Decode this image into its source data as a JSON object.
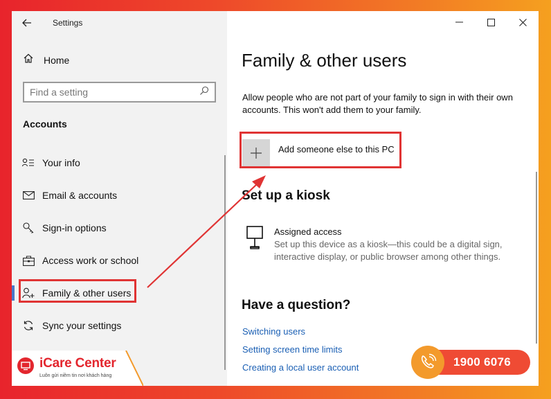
{
  "app": {
    "title": "Settings"
  },
  "sidebar": {
    "home_label": "Home",
    "search_placeholder": "Find a setting",
    "section_title": "Accounts",
    "items": [
      {
        "label": "Your info",
        "icon": "person-list-icon"
      },
      {
        "label": "Email & accounts",
        "icon": "mail-icon"
      },
      {
        "label": "Sign-in options",
        "icon": "key-icon"
      },
      {
        "label": "Access work or school",
        "icon": "briefcase-icon"
      },
      {
        "label": "Family & other users",
        "icon": "person-add-icon",
        "selected": true
      },
      {
        "label": "Sync your settings",
        "icon": "sync-icon"
      }
    ]
  },
  "content": {
    "title": "Family & other users",
    "description": "Allow people who are not part of your family to sign in with their own accounts. This won't add them to your family.",
    "add_label": "Add someone else to this PC",
    "kiosk_title": "Set up a kiosk",
    "kiosk_item": {
      "name": "Assigned access",
      "description": "Set up this device as a kiosk—this could be a digital sign, interactive display, or public browser among other things."
    },
    "question_title": "Have a question?",
    "links": [
      "Switching users",
      "Setting screen time limits",
      "Creating a local user account"
    ]
  },
  "branding": {
    "logo_name": "iCare Center",
    "logo_slogan": "Luôn gửi niềm tin nơi khách hàng",
    "hotline": "1900 6076"
  },
  "colors": {
    "accent": "#4a78c9",
    "highlight": "#e03434",
    "link": "#1a5fb4",
    "brand_red": "#e3262e",
    "brand_orange": "#f39a2c"
  }
}
